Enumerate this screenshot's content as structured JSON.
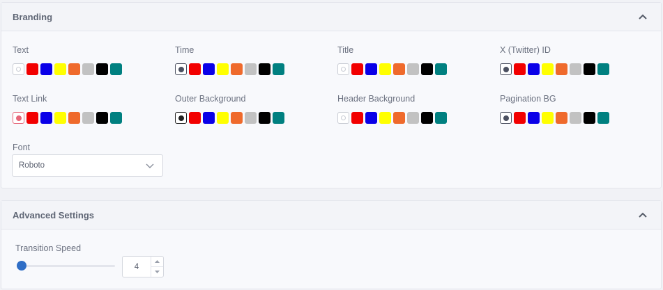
{
  "branding": {
    "title": "Branding",
    "collapse_icon": "chevron-up-icon",
    "palette": [
      "#f20000",
      "#0a00e8",
      "#ffff00",
      "#ef6a2c",
      "#c2c2c2",
      "#000000",
      "#008080"
    ],
    "fields": [
      {
        "label": "Text",
        "selector_style": "empty"
      },
      {
        "label": "Time",
        "selector_style": "filled"
      },
      {
        "label": "Title",
        "selector_style": "empty"
      },
      {
        "label": "X (Twitter) ID",
        "selector_style": "filled"
      },
      {
        "label": "Text Link",
        "selector_style": "pink"
      },
      {
        "label": "Outer Background",
        "selector_style": "black"
      },
      {
        "label": "Header Background",
        "selector_style": "empty"
      },
      {
        "label": "Pagination BG",
        "selector_style": "filled"
      }
    ],
    "font_label": "Font",
    "font_value": "Roboto"
  },
  "advanced": {
    "title": "Advanced Settings",
    "collapse_icon": "chevron-up-icon",
    "transition_label": "Transition Speed",
    "transition_value": "4",
    "slider_fraction": 0.0
  }
}
